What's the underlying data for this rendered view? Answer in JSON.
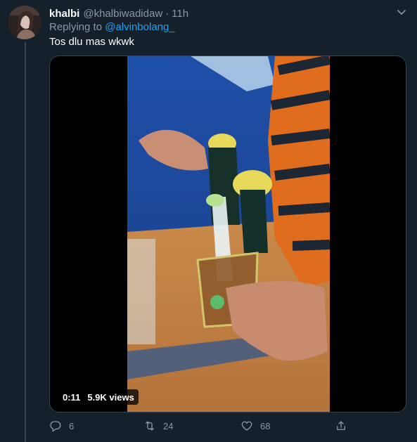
{
  "tweet": {
    "display_name": "khalbi",
    "handle": "@khalbiwadidaw",
    "separator": "·",
    "time": "11h",
    "replying_prefix": "Replying to",
    "replying_to": "@alvinbolang_",
    "text": "Tos dlu mas wkwk"
  },
  "video": {
    "duration": "0:11",
    "views": "5.9K views"
  },
  "actions": {
    "replies": "6",
    "retweets": "24",
    "likes": "68"
  },
  "icons": {
    "menu": "chevron-down-icon",
    "reply": "reply-icon",
    "retweet": "retweet-icon",
    "like": "heart-icon",
    "share": "share-icon"
  },
  "colors": {
    "background": "#15202b",
    "secondary_text": "#8899a6",
    "link": "#1da1f2",
    "border": "#38444d"
  }
}
